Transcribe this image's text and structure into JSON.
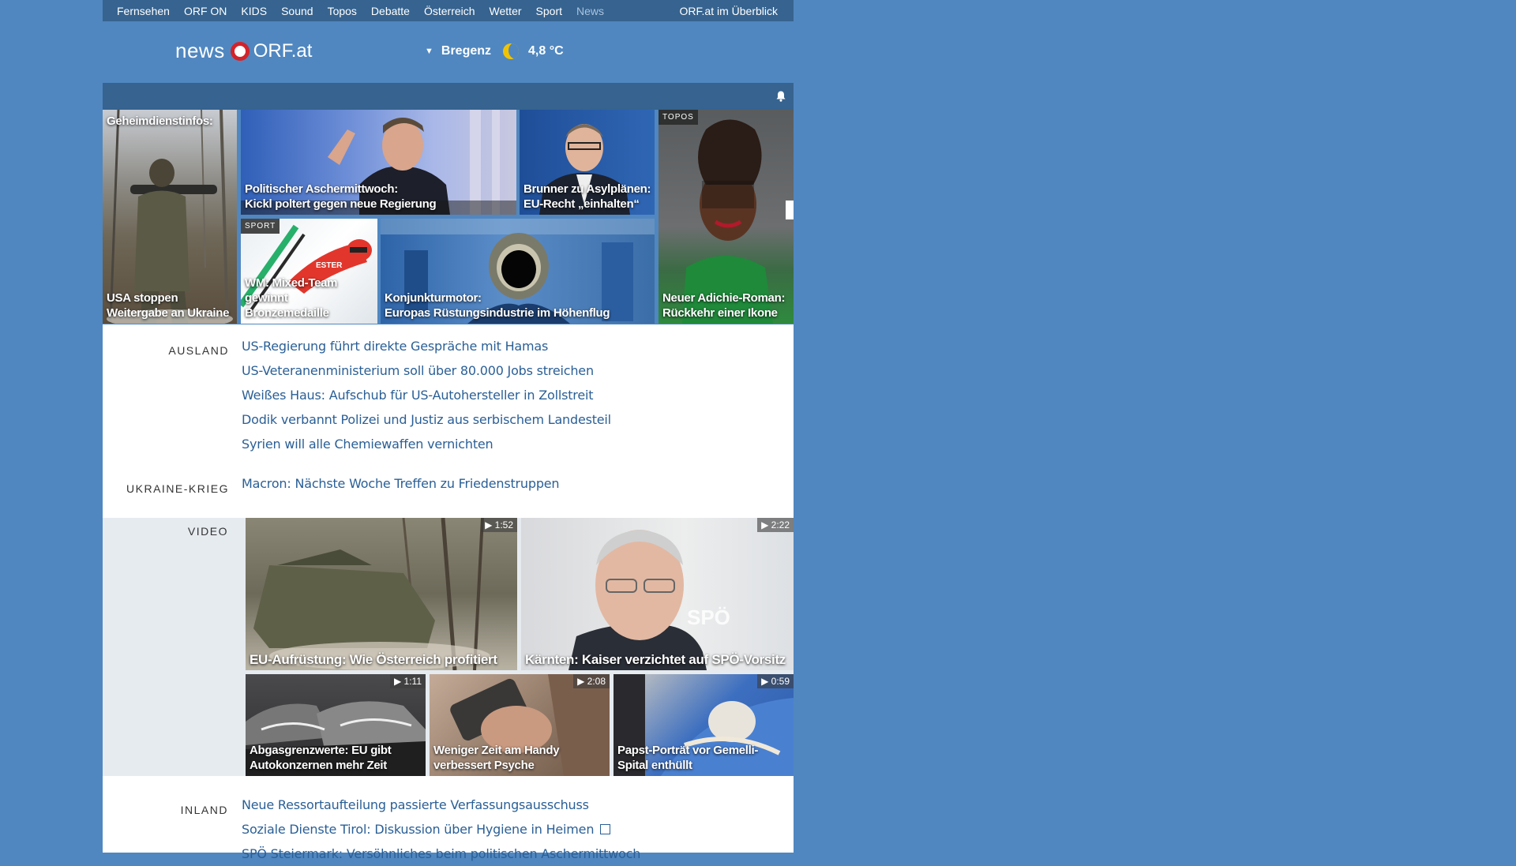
{
  "topnav": {
    "items": [
      "Fernsehen",
      "ORF ON",
      "KIDS",
      "Sound",
      "Topos",
      "Debatte",
      "Österreich",
      "Wetter",
      "Sport",
      "News"
    ],
    "overview": "ORF.at im Überblick"
  },
  "header": {
    "logo_news": "news",
    "logo_orf": "ORF.at",
    "weather_location": "Bregenz",
    "weather_temp": "4,8 °C"
  },
  "teasers": {
    "t1_top": "Geheimdienstinfos:",
    "t1_cap": "USA stoppen\nWeitergabe an Ukraine",
    "t2_cap": "Politischer Aschermittwoch:\nKickl poltert gegen neue Regierung",
    "t3_cap": "Brunner zu Asylplänen:\nEU-Recht „einhalten“",
    "t4_tag": "TOPOS",
    "t4_cap": "Neuer Adichie-Roman:\nRückkehr einer Ikone",
    "t5_tag": "SPORT",
    "t5_cap": "WM: Mixed-Team\ngewinnt Bronzemedaille",
    "t6_cap": "Konjunkturmotor:\nEuropas Rüstungsindustrie im Höhenflug"
  },
  "sections": {
    "ausland_label": "AUSLAND",
    "ausland": [
      "US-Regierung führt direkte Gespräche mit Hamas",
      "US-Veteranenministerium soll über 80.000 Jobs streichen",
      "Weißes Haus: Aufschub für US-Autohersteller in Zollstreit",
      "Dodik verbannt Polizei und Justiz aus serbischem Landesteil",
      "Syrien will alle Chemiewaffen vernichten"
    ],
    "ukraine_label": "UKRAINE-KRIEG",
    "ukraine": [
      "Macron: Nächste Woche Treffen zu Friedenstruppen"
    ],
    "video_label": "VIDEO",
    "inland_label": "INLAND",
    "inland": [
      "Neue Ressortaufteilung passierte Verfassungsausschuss",
      "Soziale Dienste Tirol: Diskussion über Hygiene in Heimen",
      "SPÖ Steiermark: Versöhnliches beim politischen Aschermittwoch"
    ]
  },
  "videos": {
    "v1_cap": "EU-Aufrüstung: Wie Österreich profitiert",
    "v1_dur": "1:52",
    "v2_cap": "Kärnten: Kaiser verzichtet auf SPÖ-Vorsitz",
    "v2_dur": "2:22",
    "v2_watermark": "SPÖ",
    "v3_cap": "Abgasgrenzwerte: EU gibt\nAutokonzernen mehr Zeit",
    "v3_dur": "1:11",
    "v4_cap": "Weniger Zeit am Handy\nverbessert Psyche",
    "v4_dur": "2:08",
    "v5_cap": "Papst-Porträt vor Gemelli-\nSpital enthüllt",
    "v5_dur": "0:59"
  },
  "colors": {
    "background": "#5087c0",
    "nav_bar": "#36638f",
    "link": "#2a5f96",
    "logo_red": "#d3232a"
  }
}
